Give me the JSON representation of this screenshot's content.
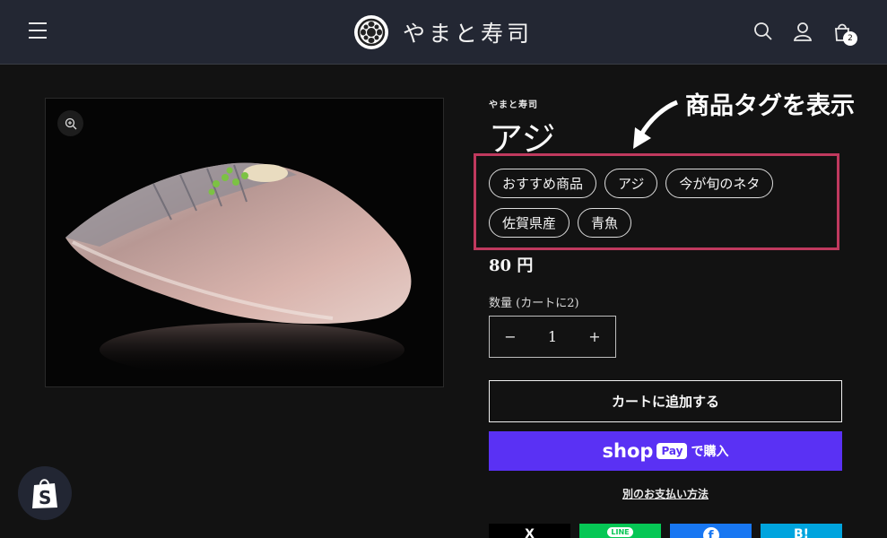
{
  "header": {
    "store_name": "やまと寿司",
    "cart_count": "2",
    "icons": [
      "menu-icon",
      "search-icon",
      "account-icon",
      "cart-icon"
    ]
  },
  "product": {
    "vendor": "やまと寿司",
    "title": "アジ",
    "tags": [
      "おすすめ商品",
      "アジ",
      "今が旬のネタ",
      "佐賀県産",
      "青魚"
    ],
    "price": "80 円",
    "quantity_label": "数量 (カートに2)",
    "quantity_value": "1",
    "minus": "−",
    "plus": "+",
    "add_to_cart": "カートに追加する",
    "shop_pay": {
      "shop": "shop",
      "pay": "Pay",
      "buy": "で購入"
    },
    "more_payment": "別のお支払い方法"
  },
  "annotation": {
    "text": "商品タグを表示"
  },
  "share": [
    {
      "name": "x",
      "label": "X",
      "color": "#000000"
    },
    {
      "name": "line",
      "label": "LINE",
      "color": "#06c755"
    },
    {
      "name": "facebook",
      "label": "f",
      "color": "#1877f2"
    },
    {
      "name": "hatena",
      "label": "B!",
      "color": "#00a4de"
    }
  ],
  "colors": {
    "background": "#121212",
    "header": "#232733",
    "annotation_border": "#c0395e",
    "shop_pay": "#5a31f4"
  }
}
